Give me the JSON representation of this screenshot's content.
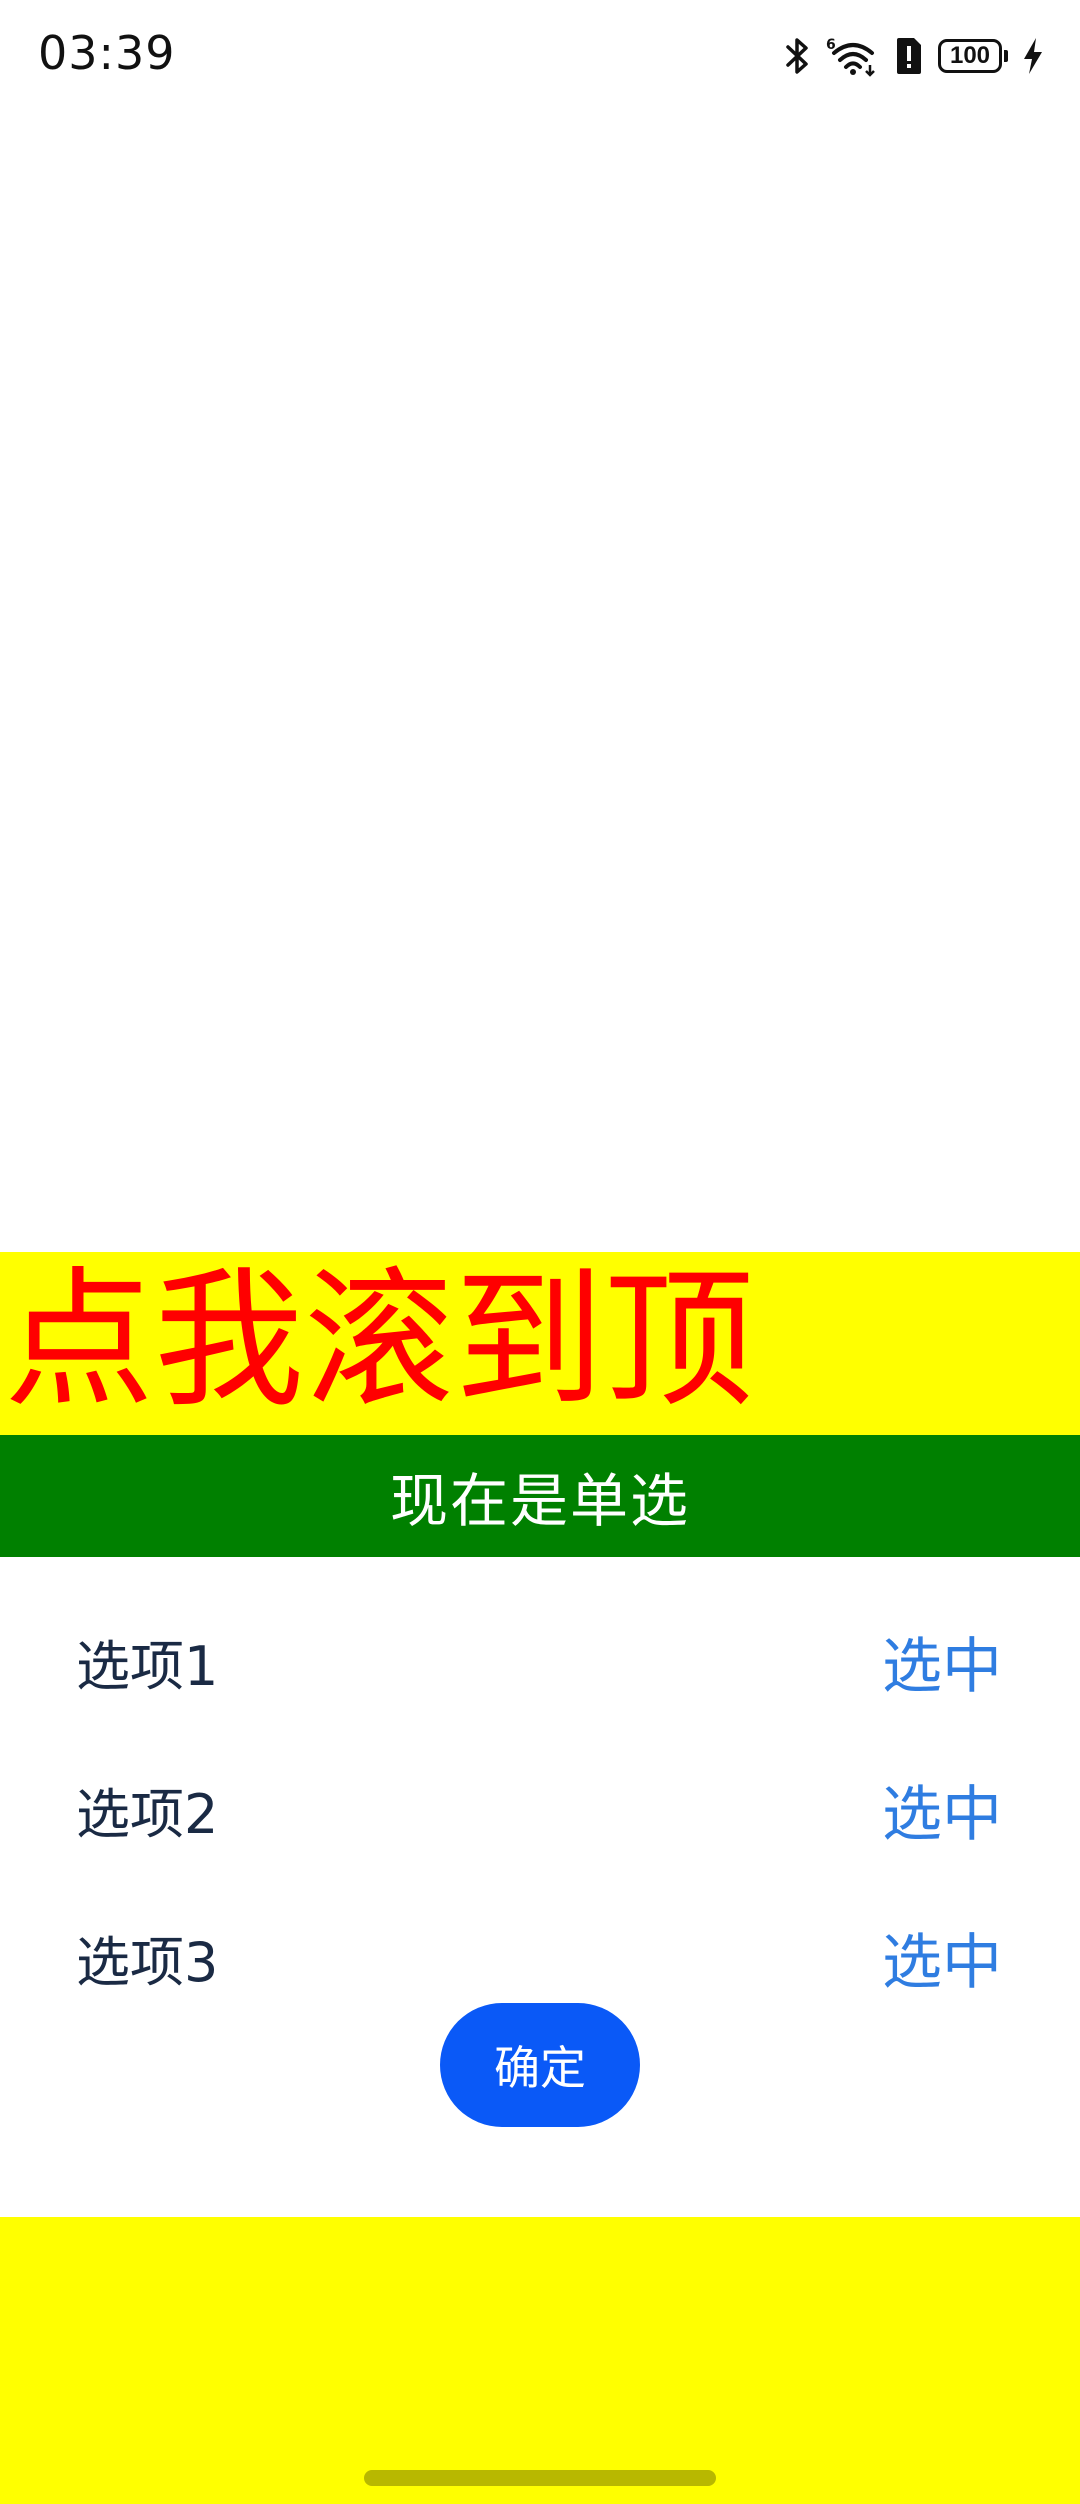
{
  "status_bar": {
    "time": "03:39",
    "battery_level": "100",
    "icons": [
      "bluetooth-icon",
      "wifi-6-icon",
      "sim-alert-icon",
      "battery-icon",
      "charging-icon"
    ]
  },
  "banner": {
    "scroll_top_label": "点我滚到顶",
    "background_color": "#ffff00",
    "text_color": "#ff0000"
  },
  "mode_header": {
    "label": "现在是单选",
    "background_color": "#008000"
  },
  "options": [
    {
      "label": "选项1",
      "action": "选中"
    },
    {
      "label": "选项2",
      "action": "选中"
    },
    {
      "label": "选项3",
      "action": "选中"
    }
  ],
  "confirm_button": {
    "label": "确定",
    "color": "#0a59f7"
  },
  "colors": {
    "action_text": "#2f7de1",
    "option_text": "#1a2a44",
    "bottom_area": "#ffff00"
  }
}
